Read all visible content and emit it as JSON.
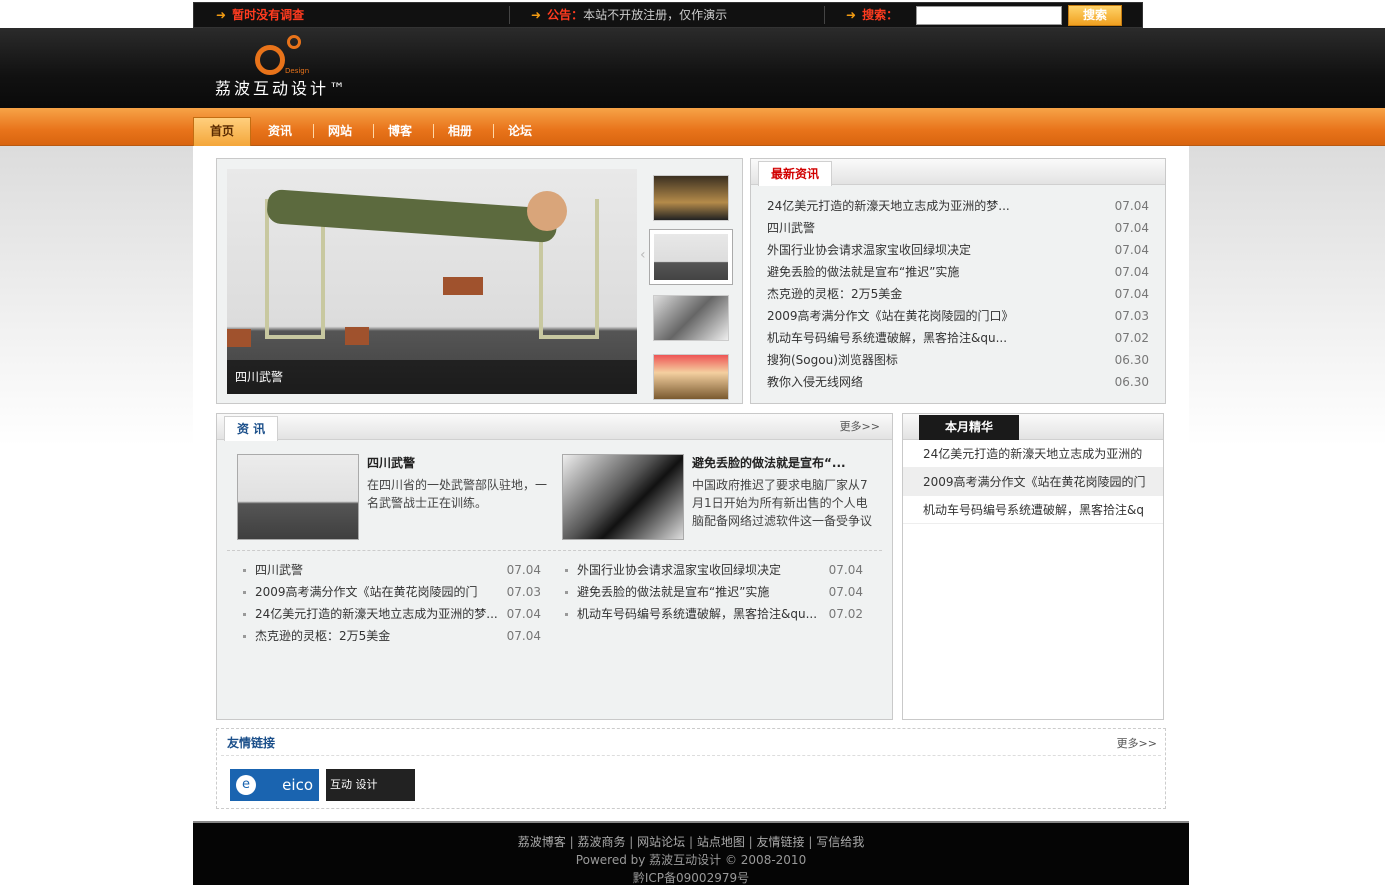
{
  "topbar": {
    "survey": "暂时没有调查",
    "notice_label": "公告：",
    "notice_text": "本站不开放注册，仅作演示",
    "search_label": "搜索：",
    "search_value": "",
    "search_button": "搜索"
  },
  "logo": {
    "text": "荔波互动设计™",
    "small": "Design"
  },
  "nav": [
    "首页",
    "资讯",
    "网站",
    "博客",
    "相册",
    "论坛"
  ],
  "slider": {
    "caption": "四川武警"
  },
  "latest": {
    "title": "最新资讯",
    "items": [
      {
        "title": "24亿美元打造的新濠天地立志成为亚洲的梦...",
        "date": "07.04"
      },
      {
        "title": "四川武警",
        "date": "07.04"
      },
      {
        "title": "外国行业协会请求温家宝收回绿坝决定",
        "date": "07.04"
      },
      {
        "title": "避免丢脸的做法就是宣布“推迟”实施",
        "date": "07.04"
      },
      {
        "title": "杰克逊的灵柩：2万5美金",
        "date": "07.04"
      },
      {
        "title": "2009高考满分作文《站在黄花岗陵园的门口》",
        "date": "07.03"
      },
      {
        "title": "机动车号码编号系统遭破解，黑客拾注&qu...",
        "date": "07.02"
      },
      {
        "title": "搜狗(Sogou)浏览器图标",
        "date": "06.30"
      },
      {
        "title": "教你入侵无线网络",
        "date": "06.30"
      }
    ]
  },
  "news": {
    "title": "资  讯",
    "more": "更多>>",
    "featured": [
      {
        "title": "四川武警",
        "desc": "在四川省的一处武警部队驻地，一名武警战士正在训练。"
      },
      {
        "title": "避免丢脸的做法就是宣布“...",
        "desc": "中国政府推迟了要求电脑厂家从7月1日开始为所有新出售的个人电脑配备网络过滤软件这一备受争议"
      }
    ],
    "left_list": [
      {
        "title": "四川武警",
        "date": "07.04"
      },
      {
        "title": "2009高考满分作文《站在黄花岗陵园的门",
        "date": "07.03"
      },
      {
        "title": "24亿美元打造的新濠天地立志成为亚洲的梦...",
        "date": "07.04"
      },
      {
        "title": "杰克逊的灵柩：2万5美金",
        "date": "07.04"
      }
    ],
    "right_list": [
      {
        "title": "外国行业协会请求温家宝收回绿坝决定",
        "date": "07.04"
      },
      {
        "title": "避免丢脸的做法就是宣布“推迟”实施",
        "date": "07.04"
      },
      {
        "title": "机动车号码编号系统遭破解，黑客拾注&qu...",
        "date": "07.02"
      }
    ]
  },
  "best": {
    "title": "本月精华",
    "items": [
      "24亿美元打造的新濠天地立志成为亚洲的",
      "2009高考满分作文《站在黄花岗陵园的门",
      "机动车号码编号系统遭破解，黑客拾注&q"
    ]
  },
  "links": {
    "title": "友情链接",
    "more": "更多>>",
    "logos": [
      "eico",
      "互动 设计"
    ]
  },
  "footer": {
    "nav": [
      "荔波博客",
      "荔波商务",
      "网站论坛",
      "站点地图",
      "友情链接",
      "写信给我"
    ],
    "powered": "Powered by 荔波互动设计 © 2008-2010",
    "icp": "黔ICP备09002979号"
  },
  "colors": {
    "accent": "#e8731a",
    "headline_red": "#d10000",
    "link_blue": "#1b4f8a"
  }
}
